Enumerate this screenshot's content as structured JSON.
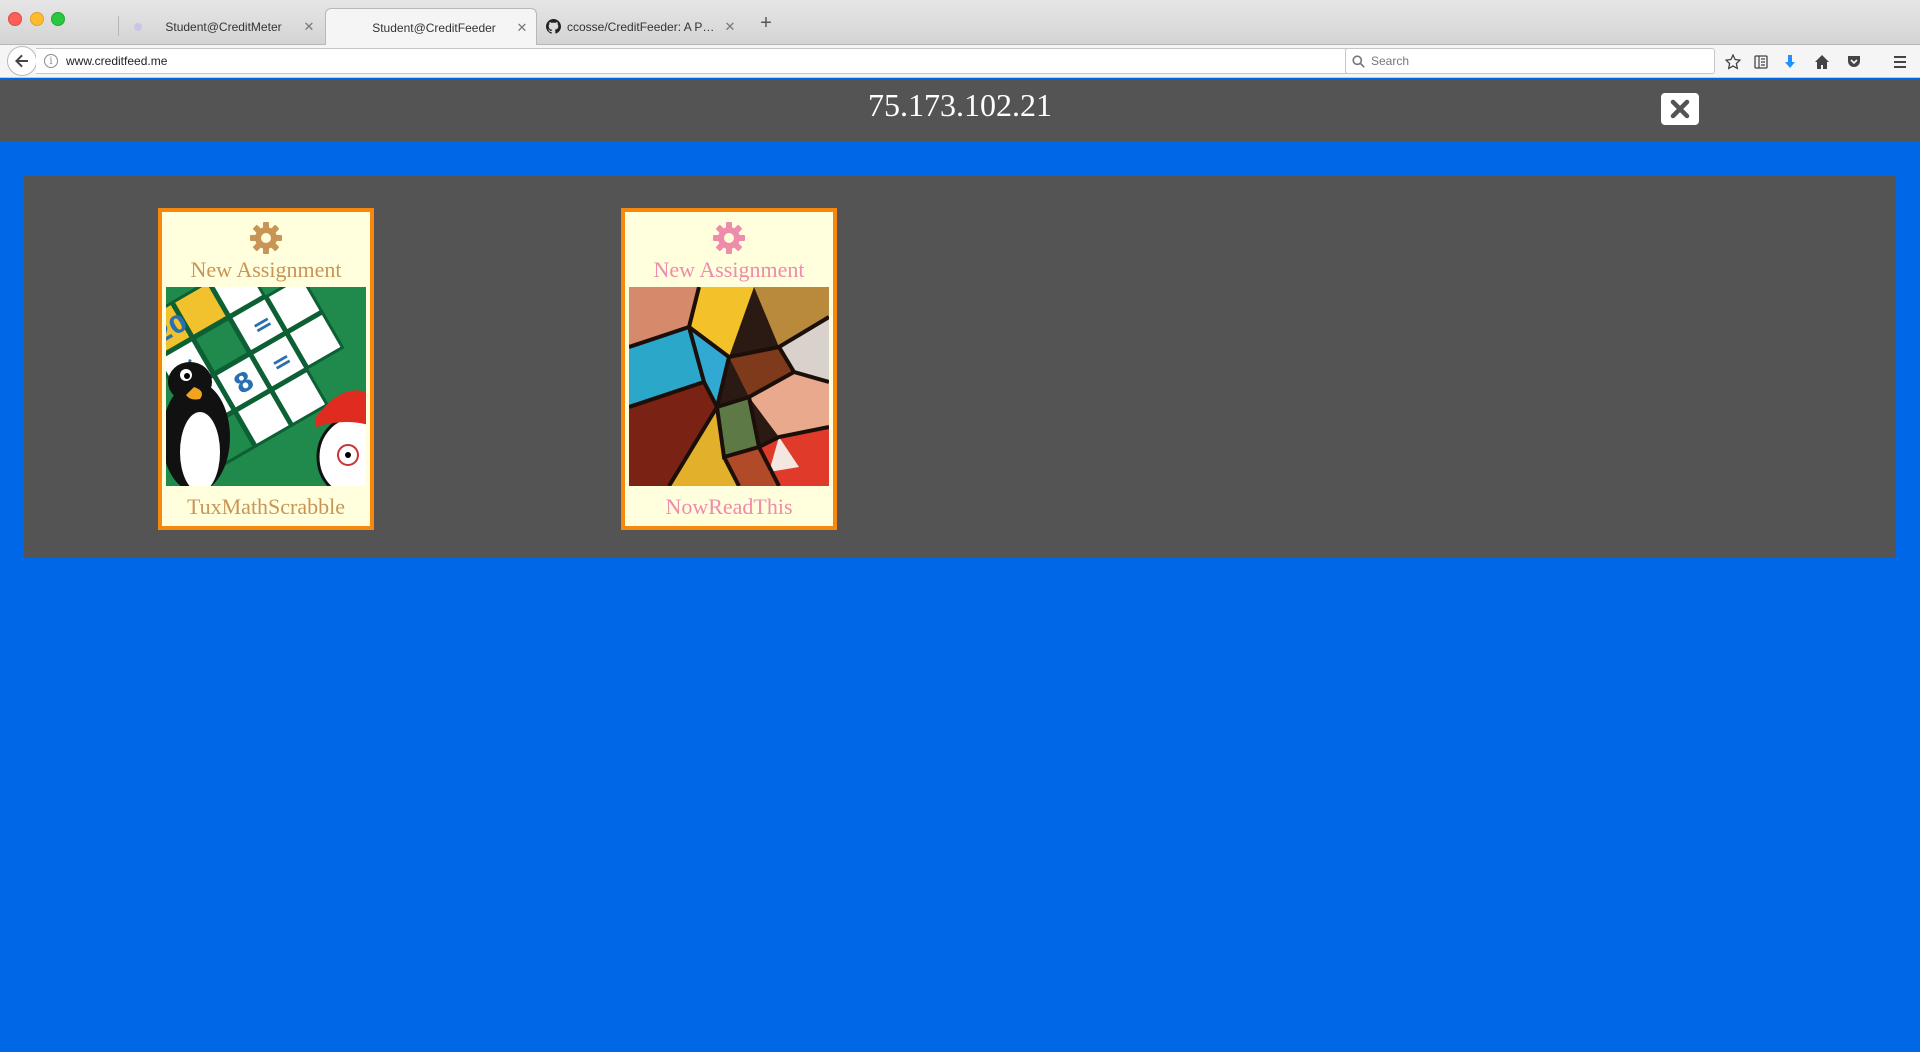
{
  "browser": {
    "tabs": [
      {
        "title": "Student@CreditMeter",
        "active": false,
        "favicon": "faded-favicon-icon"
      },
      {
        "title": "Student@CreditFeeder",
        "active": true,
        "favicon": ""
      },
      {
        "title": "ccosse/CreditFeeder: A Pro...",
        "active": false,
        "favicon": "github-icon"
      }
    ],
    "tab_close_glyph": "✕",
    "new_tab_glyph": "+",
    "url": "www.creditfeed.me",
    "search_placeholder": "Search",
    "toolbar_icons": [
      "star-icon",
      "reading-list-icon",
      "download-icon",
      "home-icon",
      "pocket-icon",
      "hamburger-menu-icon"
    ]
  },
  "page": {
    "header_title": "75.173.102.21",
    "close_icon": "close-x-icon",
    "cards": [
      {
        "assignment_label": "New Assignment",
        "app_name": "TuxMathScrabble",
        "gear_color": "#c89556",
        "text_color": "#c89556",
        "image": "tuxmath-thumbnail"
      },
      {
        "assignment_label": "New Assignment",
        "app_name": "NowReadThis",
        "gear_color": "#ef8bab",
        "text_color": "#ef8bab",
        "image": "stained-glass-thumbnail"
      }
    ]
  },
  "colors": {
    "page_background": "#0067e6",
    "header_background": "#545454",
    "card_background": "#ffffde",
    "card_border": "#f7880e"
  }
}
